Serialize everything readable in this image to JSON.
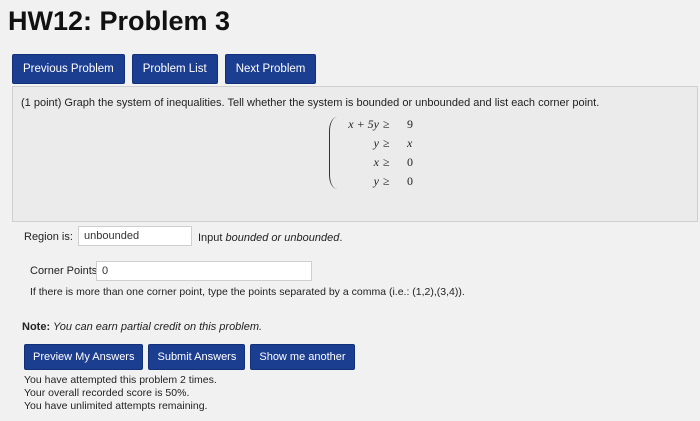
{
  "page": {
    "title": "HW12: Problem 3"
  },
  "nav": {
    "previous": "Previous Problem",
    "list": "Problem List",
    "next": "Next Problem"
  },
  "problem": {
    "text": "(1 point) Graph the system of inequalities. Tell whether the system is bounded or unbounded and list each corner point.",
    "system": [
      {
        "lhs": "x + 5y",
        "rel": "≥",
        "rhs": "9"
      },
      {
        "lhs": "y",
        "rel": "≥",
        "rhs": "x"
      },
      {
        "lhs": "x",
        "rel": "≥",
        "rhs": "0"
      },
      {
        "lhs": "y",
        "rel": "≥",
        "rhs": "0"
      }
    ]
  },
  "region": {
    "label": "Region is:",
    "value": "unbounded",
    "hint_prefix": "Input ",
    "hint_bounded": "bounded",
    "hint_or": " or ",
    "hint_unbounded": "unbounded",
    "hint_suffix": "."
  },
  "corner": {
    "label": "Corner Points:",
    "value": "0",
    "hint": "If there is more than one corner point, type the points separated by a comma (i.e.: (1,2),(3,4))."
  },
  "note": {
    "label": "Note:",
    "text": " You can earn partial credit on this problem."
  },
  "actions": {
    "preview": "Preview My Answers",
    "submit": "Submit Answers",
    "show": "Show me another"
  },
  "attempts": {
    "line1": "You have attempted this problem 2 times.",
    "line2": "Your overall recorded score is 50%.",
    "line3": "You have unlimited attempts remaining."
  },
  "colors": {
    "button": "#1c3e91",
    "background": "#f1f1f1"
  }
}
